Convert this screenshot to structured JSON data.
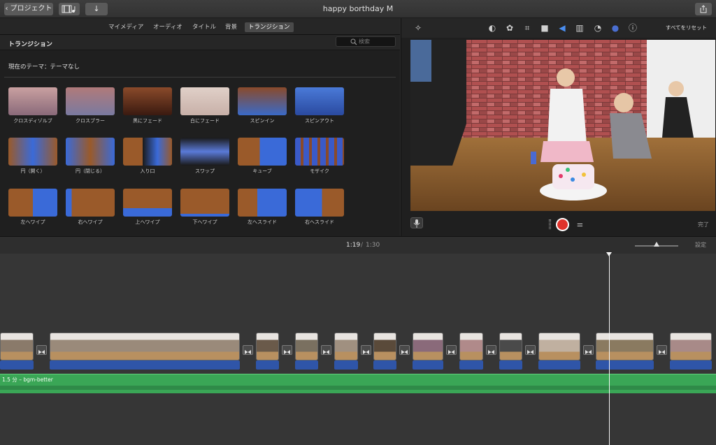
{
  "titlebar": {
    "back_label": "プロジェクト",
    "title": "happy borthday M"
  },
  "browser": {
    "tabs": [
      {
        "label": "マイメディア"
      },
      {
        "label": "オーディオ"
      },
      {
        "label": "タイトル"
      },
      {
        "label": "背景"
      },
      {
        "label": "トランジション"
      }
    ],
    "active_tab": "トランジション",
    "section_title": "トランジション",
    "search_placeholder": "検索",
    "theme_label": "現在のテーマ：テーマなし",
    "transitions": [
      {
        "label": "クロスディゾルブ"
      },
      {
        "label": "クロスブラー"
      },
      {
        "label": "黒にフェード"
      },
      {
        "label": "白にフェード"
      },
      {
        "label": "スピンイン"
      },
      {
        "label": "スピンアウト"
      },
      {
        "label": "円（開く）"
      },
      {
        "label": "円（閉じる）"
      },
      {
        "label": "入り口"
      },
      {
        "label": "スワップ"
      },
      {
        "label": "キューブ"
      },
      {
        "label": "モザイク"
      },
      {
        "label": "左へワイプ"
      },
      {
        "label": "右へワイプ"
      },
      {
        "label": "上へワイプ"
      },
      {
        "label": "下へワイプ"
      },
      {
        "label": "左へスライド"
      },
      {
        "label": "右へスライド"
      }
    ]
  },
  "viewer": {
    "reset_label": "すべてをリセット",
    "done_label": "完了",
    "tools": [
      "magic-wand-icon",
      "color-balance-icon",
      "color-correction-icon",
      "crop-icon",
      "stabilization-icon",
      "volume-icon",
      "equalizer-icon",
      "speed-icon",
      "filter-icon",
      "info-icon"
    ]
  },
  "timeline": {
    "current_time": "1:19",
    "separator": "/",
    "total_time": "1:30",
    "settings_label": "設定",
    "audio_label": "1.5 分 – bgm-better"
  },
  "colors": {
    "accent_blue": "#2f55a8",
    "audio_green": "#3aa656",
    "record_red": "#e0322b"
  }
}
